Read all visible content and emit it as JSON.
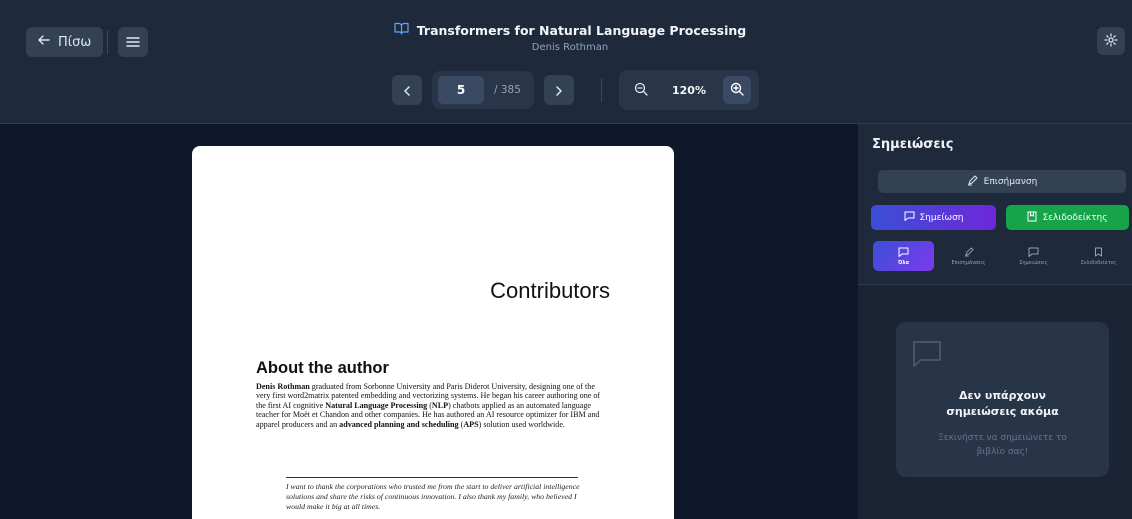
{
  "header": {
    "back_label": "Πίσω",
    "book_title": "Transformers for Natural Language Processing",
    "author": "Denis Rothman"
  },
  "pager": {
    "current_page": "5",
    "total_pages": "/ 385"
  },
  "zoom": {
    "level": "120%"
  },
  "document": {
    "heading": "Contributors",
    "section_title": "About the author",
    "bio_name": "Denis Rothman",
    "bio_part1": " graduated from Sorbonne University and Paris Diderot University, designing one of the very first word2matrix patented embedding and vectorizing systems. He began his career authoring one of the first AI cognitive ",
    "bio_nlp": "Natural Language Processing",
    "bio_nlp_abbr": "NLP",
    "bio_part2": " chatbots applied as an automated language teacher for Moët et Chandon and other companies. He has authored an AI resource optimizer for IBM and apparel producers and an ",
    "bio_aps": "advanced planning and scheduling",
    "bio_aps_abbr": "APS",
    "bio_part3": " solution used worldwide.",
    "thanks": "I want to thank the corporations who trusted me from the start to deliver artificial intelligence solutions and share the risks of continuous innovation. I also thank my family, who believed I would make it big at all times."
  },
  "sidebar": {
    "title": "Σημειώσεις",
    "highlight_button": "Επισήμανση",
    "note_button": "Σημείωση",
    "bookmark_button": "Σελιδοδείκτης",
    "tabs": [
      {
        "label": "Όλα",
        "icon": "note-icon",
        "active": true
      },
      {
        "label": "Επισημάνσεις",
        "icon": "highlighter-icon",
        "active": false
      },
      {
        "label": "Σημειώσεις",
        "icon": "note-icon",
        "active": false
      },
      {
        "label": "Σελιδοδείκτες",
        "icon": "bookmark-icon",
        "active": false
      }
    ],
    "empty_title": "Δεν υπάρχουν σημειώσεις ακόμα",
    "empty_subtitle": "Ξεκινήστε να σημειώνετε το βιβλίο σας!"
  },
  "colors": {
    "header_bg": "#1e293b",
    "reader_bg": "#0f172a",
    "note_button": "#4f46e5",
    "bookmark_button": "#16a34a"
  }
}
